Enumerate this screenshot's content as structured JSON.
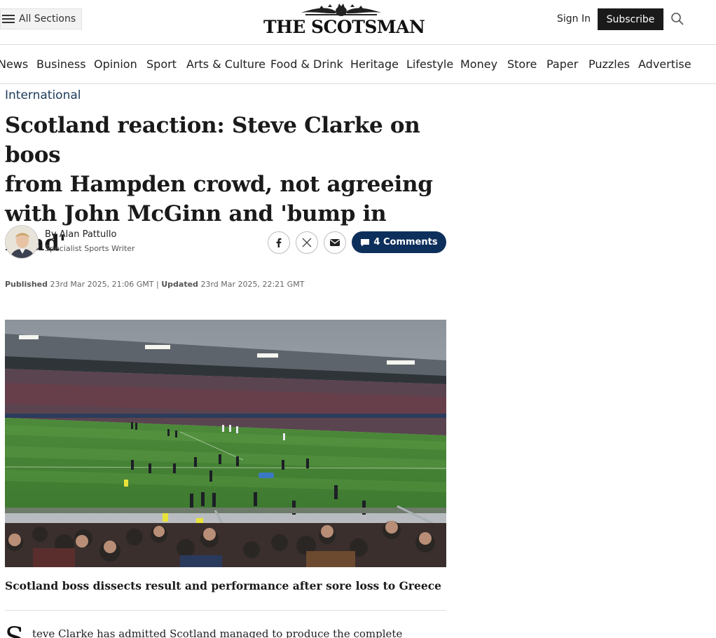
{
  "header": {
    "all_sections": "All Sections",
    "masthead": "THE SCOTSMAN",
    "sign_in": "Sign In",
    "subscribe": "Subscribe"
  },
  "nav": {
    "items": [
      "News",
      "Business",
      "Opinion",
      "Sport",
      "Arts & Culture",
      "Food & Drink",
      "Heritage",
      "Lifestyle",
      "Money",
      "Store",
      "Paper",
      "Puzzles",
      "Advertise"
    ]
  },
  "article": {
    "section": "International",
    "headline_lines": [
      "Scotland reaction: Steve Clarke on boos",
      "from Hampden crowd, not agreeing",
      "with John McGinn and 'bump in road'"
    ],
    "byline": "By Alan Pattullo",
    "author_role": "Specialist Sports Writer",
    "comments": "4 Comments",
    "published_label": "Published",
    "published": "23rd Mar 2025, 21:06 GMT",
    "updated_label": "Updated",
    "updated": "23rd Mar 2025, 22:21 GMT",
    "date_separator": "|",
    "caption": "Scotland boss dissects result and performance after sore loss to Greece",
    "lede_dropcap": "S",
    "lede_text": "teve Clarke has admitted Scotland managed to produce the complete"
  },
  "icons": {
    "menu": "hamburger-icon",
    "search": "search-icon",
    "facebook": "facebook-icon",
    "x": "x-icon",
    "email": "email-icon",
    "comment": "comment-icon"
  },
  "colors": {
    "subscribe_bg": "#1a1a1a",
    "comments_bg": "#0d2f5c",
    "section_tag": "#1b3a5b"
  }
}
